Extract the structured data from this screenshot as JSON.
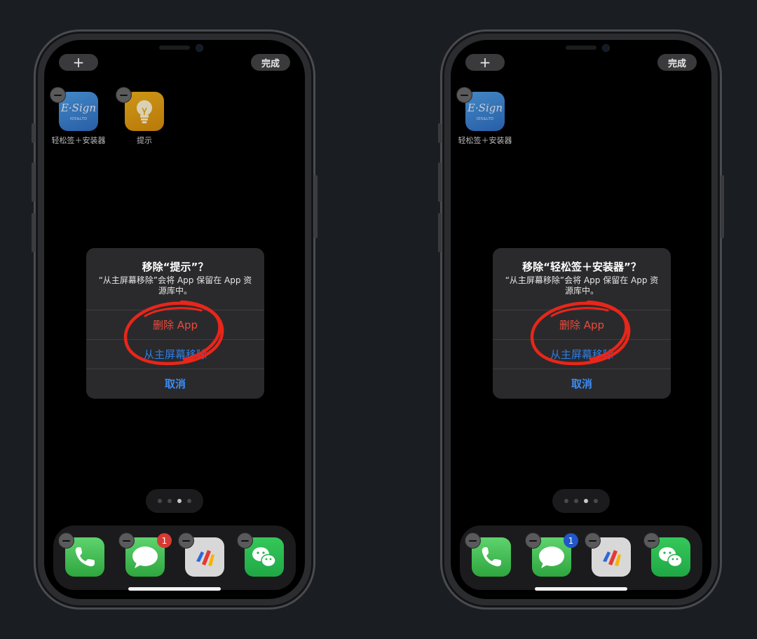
{
  "screens": [
    {
      "plus_label": "+",
      "done_label": "完成",
      "apps": [
        {
          "label": "轻松签＋安装器",
          "icon": "esign-icon"
        },
        {
          "label": "提示",
          "icon": "tips-lightbulb-icon"
        }
      ],
      "dialog": {
        "title": "移除“提示”？",
        "message": "“从主屏幕移除”会将 App 保留在 App 资源库中。",
        "delete_label": "删除 App",
        "remove_label": "从主屏幕移除",
        "cancel_label": "取消"
      },
      "messages_badge": "1",
      "page_dots": {
        "count": 4,
        "active": 3
      }
    },
    {
      "plus_label": "+",
      "done_label": "完成",
      "apps": [
        {
          "label": "轻松签＋安装器",
          "icon": "esign-icon"
        }
      ],
      "dialog": {
        "title": "移除“轻松签＋安装器”？",
        "message": "“从主屏幕移除”会将 App 保留在 App 资源库中。",
        "delete_label": "删除 App",
        "remove_label": "从主屏幕移除",
        "cancel_label": "取消"
      },
      "messages_badge": "1",
      "page_dots": {
        "count": 4,
        "active": 3
      }
    }
  ],
  "esign_logo_text": "E·Sign",
  "esign_sub_text": "IOS&LTD",
  "dock_icons": [
    "phone-icon",
    "messages-icon",
    "v-app-icon",
    "wechat-icon"
  ],
  "colors": {
    "background": "#1a1d21",
    "delete": "#ea4b3e",
    "action": "#3b8cf5",
    "annotation": "#e8261a",
    "badge_left": "#d83a33",
    "badge_right": "#2157c8"
  }
}
